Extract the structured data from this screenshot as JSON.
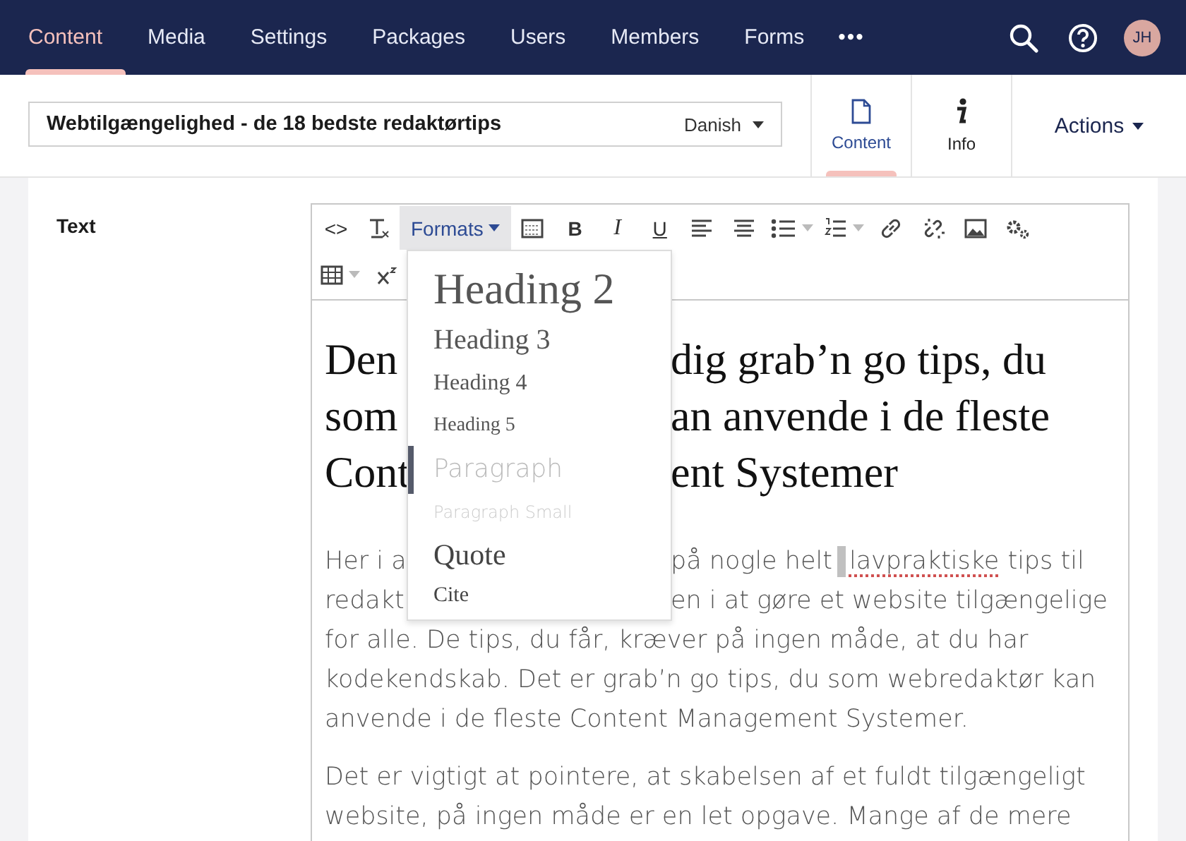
{
  "top_nav": {
    "items": [
      {
        "label": "Content",
        "selected": true
      },
      {
        "label": "Media",
        "selected": false
      },
      {
        "label": "Settings",
        "selected": false
      },
      {
        "label": "Packages",
        "selected": false
      },
      {
        "label": "Users",
        "selected": false
      },
      {
        "label": "Members",
        "selected": false
      },
      {
        "label": "Forms",
        "selected": false
      }
    ],
    "more": "•••",
    "avatar": "JH"
  },
  "header": {
    "name": "Webtilgængelighed - de 18 bedste redaktørtips",
    "language": "Danish",
    "apps": [
      {
        "label": "Content",
        "kind": "document",
        "selected": true
      },
      {
        "label": "Info",
        "kind": "info",
        "selected": false
      }
    ],
    "actions": "Actions"
  },
  "field": {
    "label": "Text"
  },
  "toolbar": {
    "rows": [
      [
        {
          "kind": "code",
          "glyph": "<>"
        },
        {
          "kind": "clear"
        },
        {
          "kind": "formats",
          "label": "Formats",
          "open": true
        },
        {
          "kind": "template"
        },
        {
          "kind": "bold",
          "glyph": "B"
        },
        {
          "kind": "italic",
          "glyph": "I"
        },
        {
          "kind": "underline",
          "glyph": "U"
        },
        {
          "kind": "align-left"
        },
        {
          "kind": "align-center"
        },
        {
          "kind": "bullets",
          "split": true
        },
        {
          "kind": "numbers",
          "split": true
        },
        {
          "kind": "link"
        },
        {
          "kind": "unlink"
        },
        {
          "kind": "image"
        },
        {
          "kind": "macro"
        }
      ],
      [
        {
          "kind": "table",
          "split": true
        },
        {
          "kind": "superscript"
        }
      ]
    ]
  },
  "formats_menu": [
    {
      "label": "Heading 2",
      "kind": "h2",
      "selected": false
    },
    {
      "label": "Heading 3",
      "kind": "h3",
      "selected": false
    },
    {
      "label": "Heading 4",
      "kind": "h4",
      "selected": false
    },
    {
      "label": "Heading 5",
      "kind": "h5",
      "selected": false
    },
    {
      "label": "Paragraph",
      "kind": "p",
      "selected": true
    },
    {
      "label": "Paragraph Small",
      "kind": "small",
      "selected": false
    },
    {
      "label": "Quote",
      "kind": "quote",
      "selected": false
    },
    {
      "label": "Cite",
      "kind": "cite",
      "selected": false
    }
  ],
  "editor": {
    "blocks": [
      {
        "kind": "heading",
        "lines": [
          {
            "left": "Den",
            "segments": [
              {
                "text": "dig grab’n go tips, du"
              }
            ]
          },
          {
            "left": "som",
            "segments": [
              {
                "text": "an anvende i de fleste"
              }
            ]
          },
          {
            "left": "Cont",
            "segments": [
              {
                "text": "ent Systemer"
              }
            ]
          }
        ]
      },
      {
        "kind": "paragraph",
        "lines": [
          {
            "left": "Her i a",
            "segments": [
              {
                "text": "på nogle helt"
              },
              {
                "text": "lavpraktiske",
                "misspelled": true,
                "cursor": true
              },
              {
                "text": "tips til"
              }
            ]
          },
          {
            "left": "redakt",
            "segments": [
              {
                "text": "en i at gøre et website tilgængelige"
              }
            ]
          },
          {
            "segments": [
              {
                "text": "for alle. De tips, du får, kræver på ingen måde, at du har"
              }
            ]
          },
          {
            "segments": [
              {
                "text": "kodekendskab. Det er grab’n go tips, du som webredaktør kan"
              }
            ]
          },
          {
            "segments": [
              {
                "text": "anvende i de fleste Content Management Systemer."
              }
            ]
          }
        ]
      },
      {
        "kind": "paragraph",
        "lines": [
          {
            "segments": [
              {
                "text": "Det er vigtigt at pointere, at skabelsen af et fuldt tilgængeligt"
              }
            ]
          },
          {
            "segments": [
              {
                "text": "website, på ingen måde er en let opgave. Mange af de mere"
              }
            ]
          }
        ]
      }
    ]
  }
}
